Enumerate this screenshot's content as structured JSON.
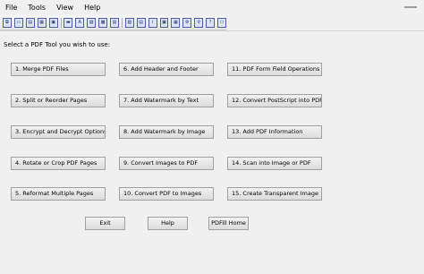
{
  "menu": [
    "File",
    "Tools",
    "View",
    "Help"
  ],
  "toolbar": {
    "icons": [
      "merge-icon",
      "split-icon",
      "encrypt-icon",
      "rotate-icon",
      "reformat-icon",
      "header-icon",
      "watermark-text-icon",
      "watermark-image-icon",
      "image-to-pdf-icon",
      "pdf-to-images-icon",
      "form-field-icon",
      "postscript-icon",
      "info-icon",
      "scan-icon",
      "transparent-image-icon",
      "settings-icon",
      "key-icon",
      "help-icon",
      "exit-icon"
    ]
  },
  "prompt": "Select a PDF Tool you wish to use:",
  "tools": [
    "1. Merge PDF Files",
    "2. Split or Reorder Pages",
    "3. Encrypt and Decrypt Options",
    "4. Rotate or Crop PDF Pages",
    "5. Reformat Multiple Pages",
    "6. Add Header and Footer",
    "7. Add Watermark by Text",
    "8. Add Watermark by Image",
    "9. Convert Images to PDF",
    "10. Convert PDF to Images",
    "11. PDF Form Field Operations",
    "12. Convert PostScript into PDF",
    "13. Add PDF Information",
    "14. Scan into Image or PDF",
    "15. Create Transparent Image"
  ],
  "bottom": {
    "exit": "Exit",
    "help": "Help",
    "home": "PDFill Home"
  }
}
